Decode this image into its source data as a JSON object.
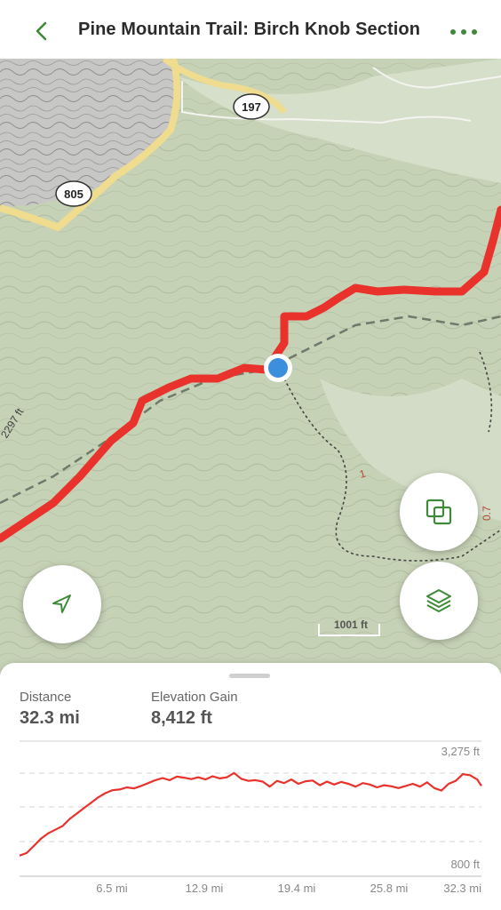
{
  "header": {
    "title": "Pine Mountain Trail: Birch Knob Section",
    "back_icon": "chevron-left-icon",
    "more_icon": "more-dots-icon",
    "accent_color": "#3f8a3a"
  },
  "map": {
    "road_labels": [
      "197",
      "805"
    ],
    "elevation_tag": "2297 ft",
    "scale_label": "1001 ft",
    "trail_markers": [
      "1",
      "0.7"
    ],
    "trail_color": "#e8322b",
    "location_dot_color": "#3b8fdc",
    "buttons": {
      "navigate_icon": "navigation-arrow-icon",
      "copy_icon": "overlay-squares-icon",
      "layers_icon": "layers-icon"
    }
  },
  "stats": {
    "distance_label": "Distance",
    "distance_value": "32.3 mi",
    "gain_label": "Elevation Gain",
    "gain_value": "8,412 ft"
  },
  "chart_data": {
    "type": "line",
    "x_ticks": [
      "6.5 mi",
      "12.9 mi",
      "19.4 mi",
      "25.8 mi",
      "32.3 mi"
    ],
    "y_top_label": "3,275 ft",
    "y_bottom_label": "800 ft",
    "ylim": [
      800,
      3275
    ],
    "line_color": "#e8322b",
    "series": [
      {
        "x": [
          0,
          0.5,
          1,
          1.5,
          2,
          2.5,
          3,
          3.5,
          4,
          4.5,
          5,
          5.5,
          6,
          6.5,
          7,
          7.5,
          8,
          8.5,
          9,
          9.5,
          10,
          10.5,
          11,
          11.5,
          12,
          12.5,
          13,
          13.5,
          14,
          14.5,
          15,
          15.5,
          16,
          16.5,
          17,
          17.5,
          18,
          18.5,
          19,
          19.5,
          20,
          20.5,
          21,
          21.5,
          22,
          22.5,
          23,
          23.5,
          24,
          24.5,
          25,
          25.5,
          26,
          26.5,
          27,
          27.5,
          28,
          28.5,
          29,
          29.5,
          30,
          30.5,
          31,
          31.5,
          32,
          32.3
        ],
        "y": [
          880,
          950,
          1150,
          1350,
          1500,
          1600,
          1700,
          1900,
          2050,
          2200,
          2350,
          2500,
          2620,
          2700,
          2720,
          2780,
          2750,
          2820,
          2900,
          2980,
          3040,
          2980,
          3080,
          3050,
          3010,
          3060,
          3000,
          3090,
          3030,
          3060,
          3180,
          3020,
          2960,
          2980,
          2940,
          2800,
          2960,
          2900,
          3000,
          2880,
          2950,
          2970,
          2840,
          2940,
          2860,
          2930,
          2880,
          2800,
          2900,
          2860,
          2780,
          2840,
          2810,
          2760,
          2820,
          2880,
          2800,
          2920,
          2760,
          2690,
          2880,
          2960,
          3150,
          3120,
          3000,
          2820
        ]
      }
    ]
  }
}
